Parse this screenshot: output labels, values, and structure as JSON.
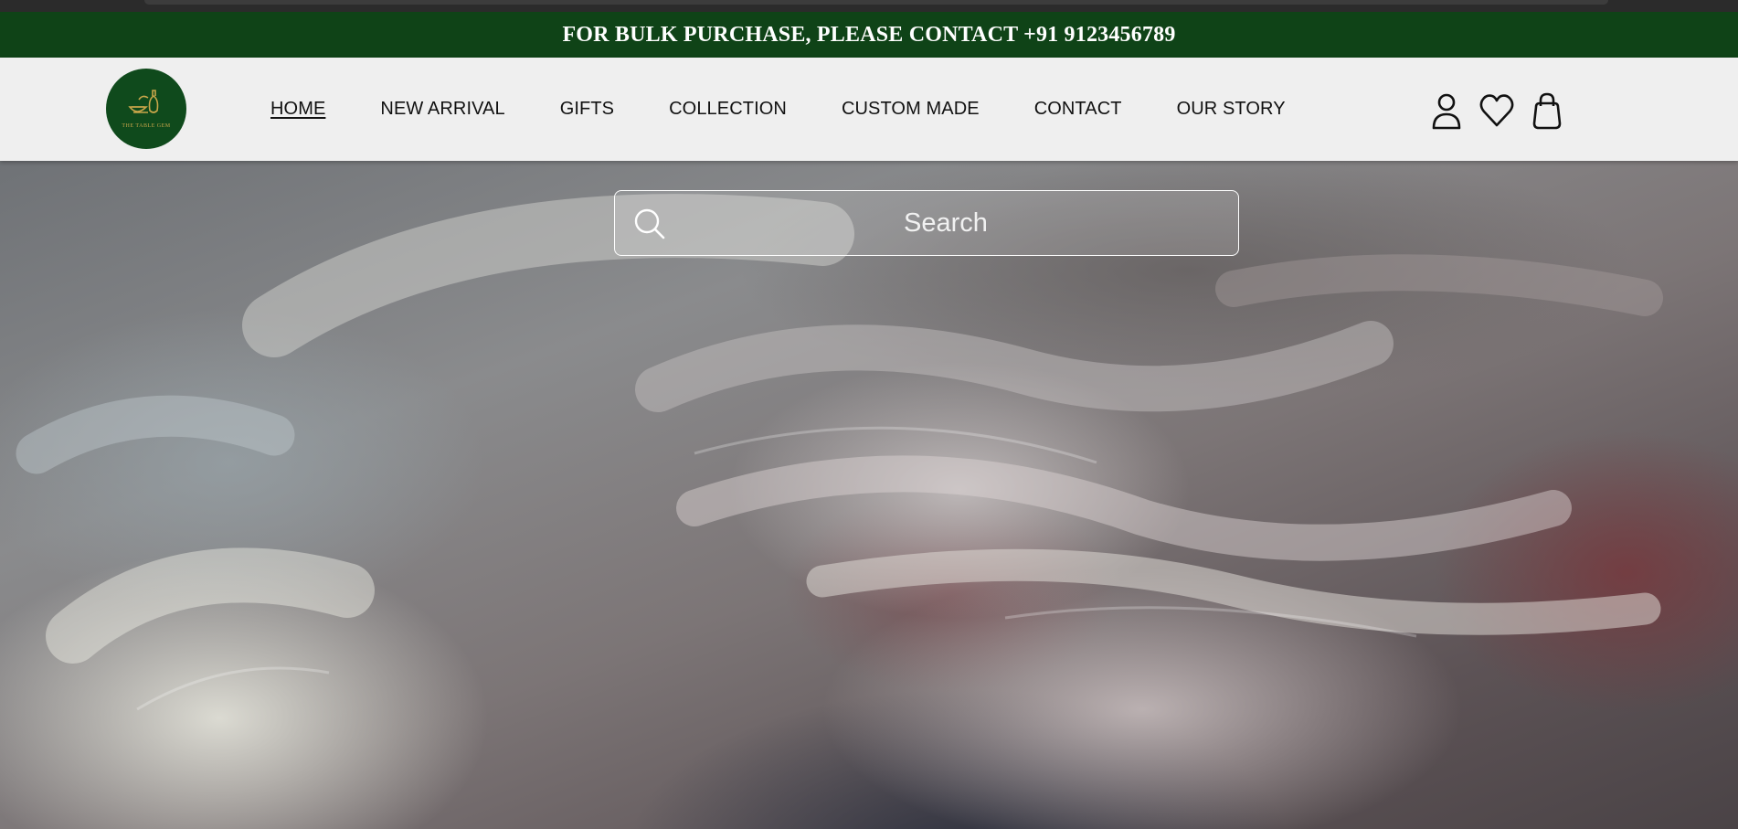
{
  "promo": {
    "text": "FOR BULK PURCHASE, PLEASE CONTACT +91 9123456789",
    "background": "#0f4317"
  },
  "header": {
    "logo": {
      "name": "logo",
      "text": "THE TABLE GEM",
      "color": "#0f4a1c",
      "accent": "#c9a64a"
    },
    "nav": [
      {
        "label": "HOME",
        "active": true
      },
      {
        "label": "NEW ARRIVAL"
      },
      {
        "label": "GIFTS"
      },
      {
        "label": "COLLECTION"
      },
      {
        "label": "CUSTOM MADE"
      },
      {
        "label": "CONTACT"
      },
      {
        "label": "OUR STORY"
      }
    ],
    "icons": [
      "user-icon",
      "heart-icon",
      "shopping-bag-icon"
    ]
  },
  "hero": {
    "search": {
      "placeholder": "Search",
      "icon": "search-icon"
    }
  }
}
